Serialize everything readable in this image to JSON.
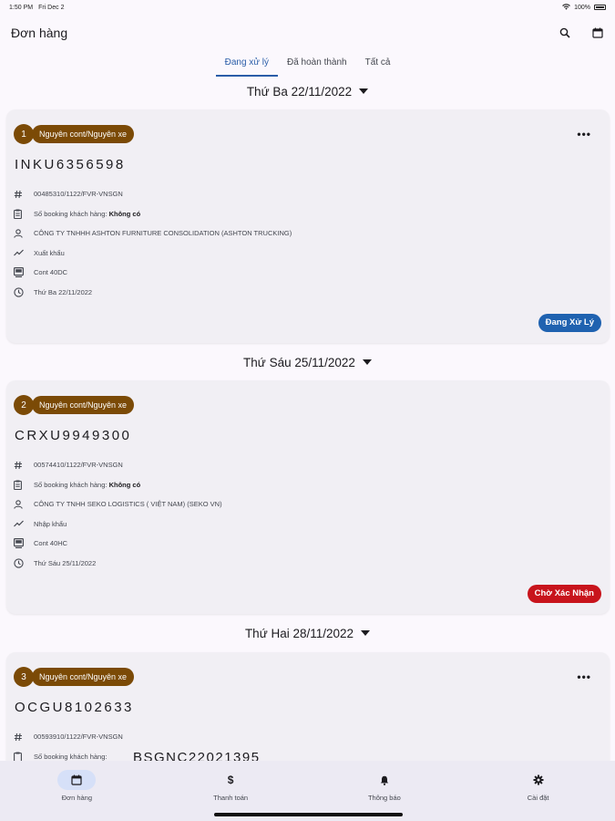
{
  "status_bar": {
    "time": "1:50 PM",
    "date": "Fri Dec 2",
    "battery": "100%"
  },
  "header": {
    "title": "Đơn hàng",
    "search_icon": "search-icon",
    "calendar_icon": "calendar-icon"
  },
  "tabs": [
    {
      "label": "Đang xử lý",
      "active": true
    },
    {
      "label": "Đã hoàn thành",
      "active": false
    },
    {
      "label": "Tất cả",
      "active": false
    }
  ],
  "groups": [
    {
      "date_label": "Thứ Ba 22/11/2022",
      "order": {
        "number": "1",
        "type": "Nguyên cont/Nguyên xe",
        "container": "INKU6356598",
        "code": "00485310/1122/FVR-VNSGN",
        "booking_label": "Số booking khách hàng:",
        "booking_value": "Không có",
        "customer": "CÔNG TY TNHHH ASHTON FURNITURE CONSOLIDATION  (ASHTON TRUCKING)",
        "direction": "Xuất khẩu",
        "cont_type": "Cont 40DC",
        "date": "Thứ Ba 22/11/2022",
        "status": "Đang Xử Lý",
        "status_color": "#1f62b0"
      }
    },
    {
      "date_label": "Thứ Sáu 25/11/2022",
      "order": {
        "number": "2",
        "type": "Nguyên cont/Nguyên xe",
        "container": "CRXU9949300",
        "code": "00574410/1122/FVR-VNSGN",
        "booking_label": "Số booking khách hàng:",
        "booking_value": "Không có",
        "customer": "CÔNG TY TNHH SEKO LOGISTICS ( VIỆT NAM) (SEKO VN)",
        "direction": "Nhập khẩu",
        "cont_type": "Cont 40HC",
        "date": "Thứ Sáu 25/11/2022",
        "status": "Chờ Xác Nhận",
        "status_color": "#c8141c"
      }
    },
    {
      "date_label": "Thứ Hai 28/11/2022",
      "order": {
        "number": "3",
        "type": "Nguyên cont/Nguyên xe",
        "container": "OCGU8102633",
        "code": "00593910/1122/FVR-VNSGN",
        "booking_label": "Số booking khách hàng:",
        "booking_value": "BSGNC22021395"
      }
    }
  ],
  "bottom_nav": [
    {
      "label": "Đơn hàng",
      "icon": "calendar-icon",
      "active": true
    },
    {
      "label": "Thanh toán",
      "icon": "dollar-icon",
      "active": false
    },
    {
      "label": "Thông báo",
      "icon": "bell-icon",
      "active": false
    },
    {
      "label": "Cài đặt",
      "icon": "gear-icon",
      "active": false
    }
  ],
  "colors": {
    "accent": "#2a5da8",
    "badge_brown": "#7b4a06",
    "card_bg": "#f1eff4"
  }
}
